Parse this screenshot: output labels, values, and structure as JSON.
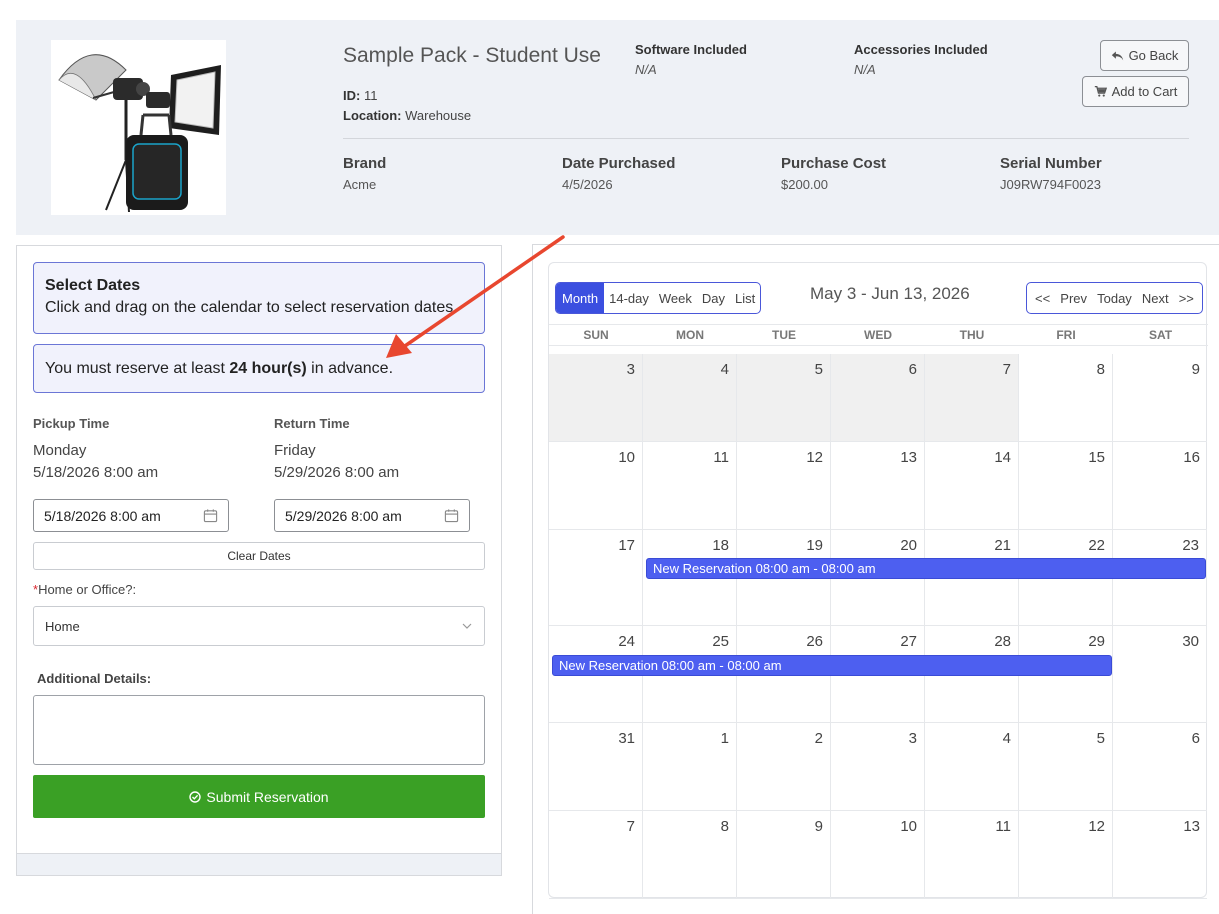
{
  "product": {
    "title": "Sample Pack - Student Use",
    "id_label": "ID:",
    "id_value": "11",
    "location_label": "Location:",
    "location_value": "Warehouse",
    "software_label": "Software Included",
    "software_value": "N/A",
    "accessories_label": "Accessories Included",
    "accessories_value": "N/A",
    "brand_label": "Brand",
    "brand_value": "Acme",
    "date_purchased_label": "Date Purchased",
    "date_purchased_value": "4/5/2026",
    "purchase_cost_label": "Purchase Cost",
    "purchase_cost_value": "$200.00",
    "serial_label": "Serial Number",
    "serial_value": "J09RW794F0023"
  },
  "actions": {
    "go_back": "Go Back",
    "add_to_cart": "Add to Cart"
  },
  "form": {
    "select_dates_title": "Select Dates",
    "select_dates_text": "Click and drag on the calendar to select reservation dates.",
    "advance_prefix": "You must reserve at least ",
    "advance_bold": "24 hour(s)",
    "advance_suffix": " in advance.",
    "pickup_label": "Pickup Time",
    "pickup_day": "Monday",
    "pickup_datetime": "5/18/2026 8:00 am",
    "pickup_input": "5/18/2026 8:00 am",
    "return_label": "Return Time",
    "return_day": "Friday",
    "return_datetime": "5/29/2026 8:00 am",
    "return_input": "5/29/2026 8:00 am",
    "clear_dates": "Clear Dates",
    "home_required_mark": "*",
    "home_label": "Home or Office?:",
    "home_value": "Home",
    "details_label": "Additional Details:",
    "details_value": "",
    "submit": "Submit Reservation"
  },
  "calendar": {
    "views": [
      "Month",
      "14-day",
      "Week",
      "Day",
      "List"
    ],
    "active_view": "Month",
    "title": "May 3 - Jun 13, 2026",
    "nav": [
      "<<",
      "Prev",
      "Today",
      "Next",
      ">>"
    ],
    "weekdays": [
      "SUN",
      "MON",
      "TUE",
      "WED",
      "THU",
      "FRI",
      "SAT"
    ],
    "weeks": [
      [
        "3",
        "4",
        "5",
        "6",
        "7",
        "8",
        "9"
      ],
      [
        "10",
        "11",
        "12",
        "13",
        "14",
        "15",
        "16"
      ],
      [
        "17",
        "18",
        "19",
        "20",
        "21",
        "22",
        "23"
      ],
      [
        "24",
        "25",
        "26",
        "27",
        "28",
        "29",
        "30"
      ],
      [
        "31",
        "1",
        "2",
        "3",
        "4",
        "5",
        "6"
      ],
      [
        "7",
        "8",
        "9",
        "10",
        "11",
        "12",
        "13"
      ]
    ],
    "past_days_week0": [
      true,
      true,
      true,
      true,
      true,
      false,
      false
    ],
    "events": [
      {
        "label": "New Reservation 08:00 am - 08:00 am"
      },
      {
        "label": "New Reservation 08:00 am - 08:00 am"
      }
    ]
  },
  "colors": {
    "accent": "#3b4fe0",
    "event": "#4d5ff0",
    "submit": "#3aa025",
    "annotation_arrow": "#e8472f"
  },
  "icons": {
    "go_back": "reply-icon",
    "add_to_cart": "cart-icon",
    "date_input": "calendar-icon",
    "select": "chevron-down-icon",
    "submit": "check-circle-icon"
  }
}
